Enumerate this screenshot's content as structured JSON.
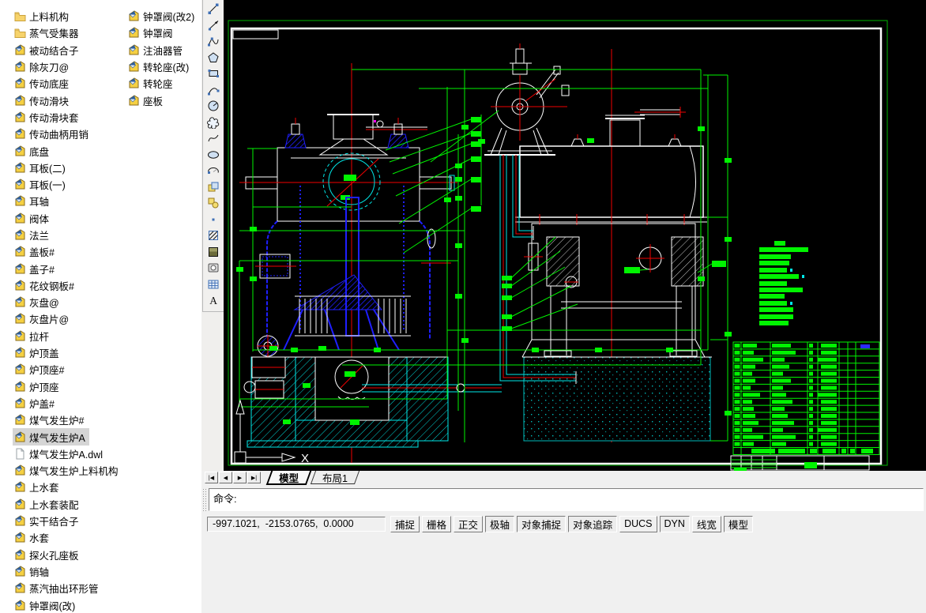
{
  "colors": {
    "canvas_bg": "#000000",
    "outline_white": "#ffffff",
    "dimension_green": "#00f400",
    "boundary_green": "#00b400",
    "hatch_cyan": "#00e8e8",
    "part_blue": "#1f1fff",
    "centerline_red": "#f00000",
    "selection_gray": "#d5d5d5",
    "magenta_grip": "#ff00ff"
  },
  "file_panel": {
    "columns": [
      {
        "items": [
          {
            "label": "上料机构",
            "icon": "folder"
          },
          {
            "label": "蒸气受集器",
            "icon": "folder"
          },
          {
            "label": "被动结合子",
            "icon": "dwg"
          },
          {
            "label": "除灰刀@",
            "icon": "dwg"
          },
          {
            "label": "传动底座",
            "icon": "dwg"
          },
          {
            "label": "传动滑块",
            "icon": "dwg"
          },
          {
            "label": "传动滑块套",
            "icon": "dwg"
          },
          {
            "label": "传动曲柄用销",
            "icon": "dwg"
          },
          {
            "label": "底盘",
            "icon": "dwg"
          },
          {
            "label": "耳板(二)",
            "icon": "dwg"
          },
          {
            "label": "耳板(一)",
            "icon": "dwg"
          },
          {
            "label": "耳轴",
            "icon": "dwg"
          },
          {
            "label": "阀体",
            "icon": "dwg"
          },
          {
            "label": "法兰",
            "icon": "dwg"
          },
          {
            "label": "盖板#",
            "icon": "dwg"
          },
          {
            "label": "盖子#",
            "icon": "dwg"
          },
          {
            "label": "花纹钢板#",
            "icon": "dwg"
          },
          {
            "label": "灰盘@",
            "icon": "dwg"
          },
          {
            "label": "灰盘片@",
            "icon": "dwg"
          },
          {
            "label": "拉杆",
            "icon": "dwg"
          },
          {
            "label": "炉顶盖",
            "icon": "dwg"
          },
          {
            "label": "炉顶座#",
            "icon": "dwg"
          },
          {
            "label": "炉顶座",
            "icon": "dwg"
          },
          {
            "label": "炉盖#",
            "icon": "dwg"
          },
          {
            "label": "煤气发生炉#",
            "icon": "dwg"
          },
          {
            "label": "煤气发生炉A",
            "icon": "dwg",
            "selected": true
          },
          {
            "label": "煤气发生炉A.dwl",
            "icon": "file"
          },
          {
            "label": "煤气发生炉上料机构",
            "icon": "dwg"
          },
          {
            "label": "上水套",
            "icon": "dwg"
          },
          {
            "label": "上水套装配",
            "icon": "dwg"
          },
          {
            "label": "实干结合子",
            "icon": "dwg"
          },
          {
            "label": "水套",
            "icon": "dwg"
          },
          {
            "label": "探火孔座板",
            "icon": "dwg"
          },
          {
            "label": "销轴",
            "icon": "dwg"
          },
          {
            "label": "蒸汽抽出环形管",
            "icon": "dwg"
          },
          {
            "label": "钟罩阀(改)",
            "icon": "dwg"
          }
        ]
      },
      {
        "items": [
          {
            "label": "钟罩阀(改2)",
            "icon": "dwg"
          },
          {
            "label": "钟罩阀",
            "icon": "dwg"
          },
          {
            "label": "注油器管",
            "icon": "dwg"
          },
          {
            "label": "转轮座(改)",
            "icon": "dwg"
          },
          {
            "label": "转轮座",
            "icon": "dwg"
          },
          {
            "label": "座板",
            "icon": "dwg"
          }
        ]
      }
    ]
  },
  "toolbar": {
    "name": "draw-toolbar",
    "items": [
      {
        "name": "line"
      },
      {
        "name": "construction-line"
      },
      {
        "name": "polyline"
      },
      {
        "name": "polygon"
      },
      {
        "name": "rectangle"
      },
      {
        "name": "arc"
      },
      {
        "name": "circle"
      },
      {
        "name": "revision-cloud"
      },
      {
        "name": "spline"
      },
      {
        "name": "ellipse"
      },
      {
        "name": "ellipse-arc"
      },
      {
        "name": "insert-block"
      },
      {
        "name": "make-block"
      },
      {
        "name": "point"
      },
      {
        "name": "hatch"
      },
      {
        "name": "gradient"
      },
      {
        "name": "region"
      },
      {
        "name": "table"
      },
      {
        "name": "multiline-text",
        "glyph": "A"
      }
    ]
  },
  "canvas": {
    "ucs_x_label": "X",
    "tab_nav": [
      "|◀",
      "◀",
      "▶",
      "▶|"
    ],
    "tabs": [
      {
        "label": "模型",
        "active": true
      },
      {
        "label": "布局1",
        "active": false
      }
    ]
  },
  "command": {
    "prompt": "命令:"
  },
  "statusbar": {
    "coordinates": "-997.1021,  -2153.0765,  0.0000",
    "buttons": [
      {
        "label": "捕捉",
        "pressed": false
      },
      {
        "label": "栅格",
        "pressed": false
      },
      {
        "label": "正交",
        "pressed": false
      },
      {
        "label": "极轴",
        "pressed": true
      },
      {
        "label": "对象捕捉",
        "pressed": true
      },
      {
        "label": "对象追踪",
        "pressed": true
      },
      {
        "label": "DUCS",
        "pressed": false
      },
      {
        "label": "DYN",
        "pressed": true
      },
      {
        "label": "线宽",
        "pressed": false
      },
      {
        "label": "模型",
        "pressed": true
      }
    ]
  }
}
